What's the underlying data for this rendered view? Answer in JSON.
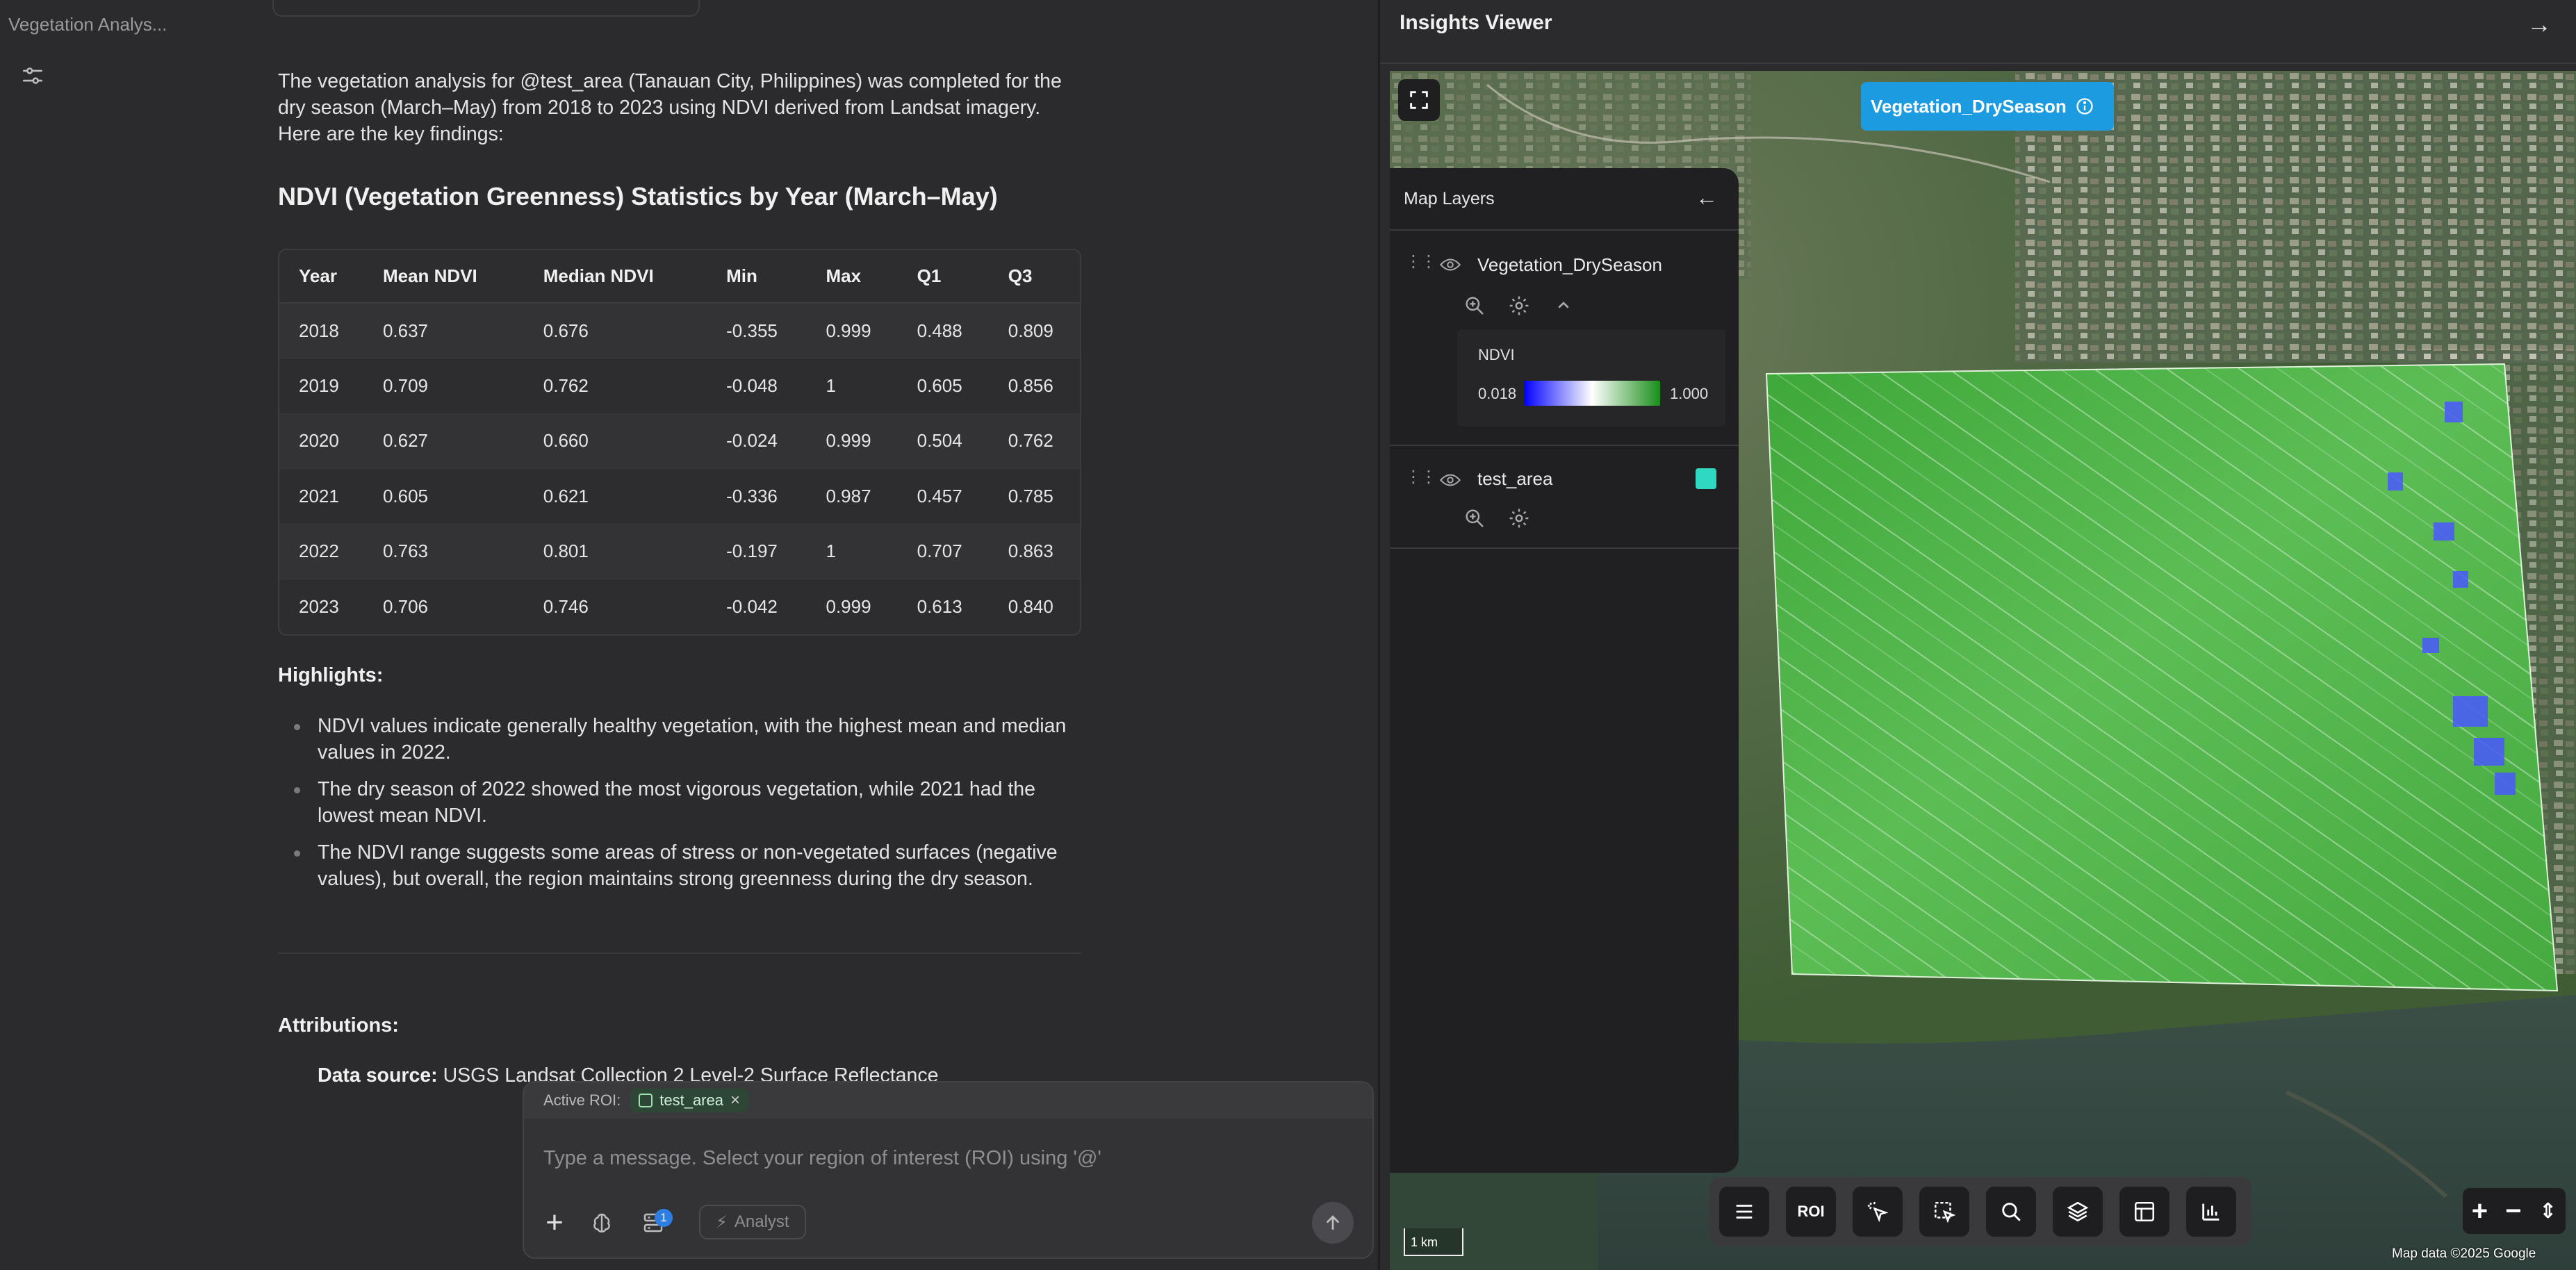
{
  "sidebar": {
    "title": "Vegetation Analys..."
  },
  "chat": {
    "intro": "The vegetation analysis for @test_area (Tanauan City, Philippines) was completed for the dry season (March–May) from 2018 to 2023 using NDVI derived from Landsat imagery. Here are the key findings:",
    "stats_heading": "NDVI (Vegetation Greenness) Statistics by Year (March–May)",
    "table": {
      "headers": [
        "Year",
        "Mean NDVI",
        "Median NDVI",
        "Min",
        "Max",
        "Q1",
        "Q3"
      ],
      "rows": [
        [
          "2018",
          "0.637",
          "0.676",
          "-0.355",
          "0.999",
          "0.488",
          "0.809"
        ],
        [
          "2019",
          "0.709",
          "0.762",
          "-0.048",
          "1",
          "0.605",
          "0.856"
        ],
        [
          "2020",
          "0.627",
          "0.660",
          "-0.024",
          "0.999",
          "0.504",
          "0.762"
        ],
        [
          "2021",
          "0.605",
          "0.621",
          "-0.336",
          "0.987",
          "0.457",
          "0.785"
        ],
        [
          "2022",
          "0.763",
          "0.801",
          "-0.197",
          "1",
          "0.707",
          "0.863"
        ],
        [
          "2023",
          "0.706",
          "0.746",
          "-0.042",
          "0.999",
          "0.613",
          "0.840"
        ]
      ]
    },
    "highlights_title": "Highlights:",
    "highlights": [
      "NDVI values indicate generally healthy vegetation, with the highest mean and median values in 2022.",
      "The dry season of 2022 showed the most vigorous vegetation, while 2021 had the lowest mean NDVI.",
      "The NDVI range suggests some areas of stress or non-vegetated surfaces (negative values), but overall, the region maintains strong greenness during the dry season."
    ],
    "attributions_title": "Attributions:",
    "attribution_label": "Data source:",
    "attribution_text": " USGS Landsat Collection 2 Level-2 Surface Reflectance"
  },
  "composer": {
    "active_roi_label": "Active ROI:",
    "roi_name": "test_area",
    "roi_remove": "×",
    "placeholder": "Type a message. Select your region of interest (ROI) using '@'",
    "plus": "+",
    "datasets_badge": "1",
    "mode_label": "Analyst"
  },
  "viewer": {
    "title": "Insights Viewer",
    "active_layer_pill": "Vegetation_DrySeason",
    "layers_panel_title": "Map Layers",
    "layers": [
      {
        "name": "Vegetation_DrySeason",
        "legend": {
          "title": "NDVI",
          "min": "0.018",
          "max": "1.000",
          "colors": [
            "#0000ff",
            "#ffffff",
            "#1a8f1a"
          ]
        }
      },
      {
        "name": "test_area",
        "swatch_color": "#2fd8c0"
      }
    ],
    "tools": {
      "roi_label": "ROI"
    },
    "zoom": {
      "in": "+",
      "out": "−"
    },
    "scale_label": "1 km",
    "map_attribution": "Map data ©2025 Google"
  }
}
